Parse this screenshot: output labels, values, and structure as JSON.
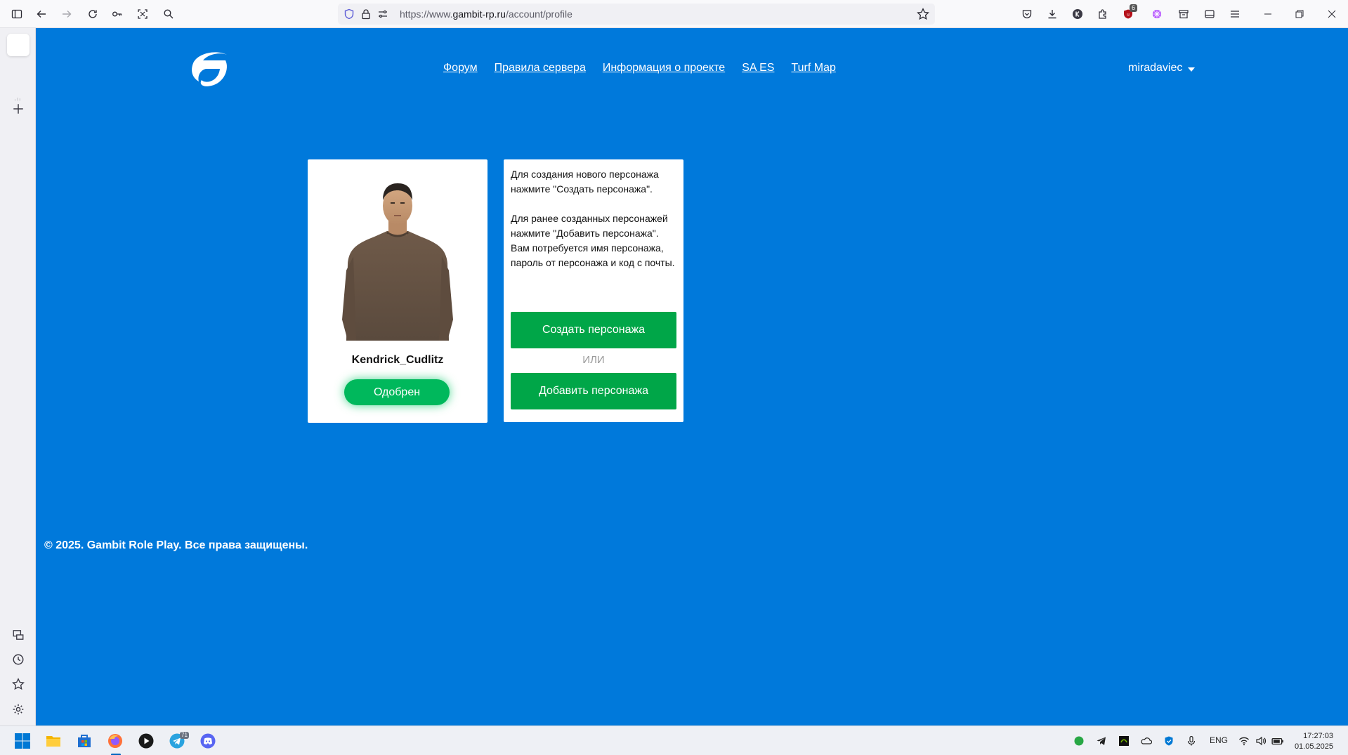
{
  "browser": {
    "url_prefix": "https://www.",
    "url_domain": "gambit-rp.ru",
    "url_path": "/account/profile",
    "extension_badge": "6"
  },
  "site": {
    "nav": [
      {
        "label": "Форум"
      },
      {
        "label": "Правила сервера"
      },
      {
        "label": "Информация о проекте"
      },
      {
        "label": "SA ES"
      },
      {
        "label": "Turf Map"
      }
    ],
    "username": "miradaviec",
    "character": {
      "name": "Kendrick_Cudlitz",
      "status": "Одобрен"
    },
    "info": {
      "paragraph1": "Для создания нового персонажа нажмите \"Создать персонажа\".",
      "paragraph2": "Для ранее созданных персонажей нажмите \"Добавить персонажа\". Вам потребуется имя персонажа, пароль от персонажа и код с почты.",
      "create_button": "Создать персонажа",
      "or_text": "ИЛИ",
      "add_button": "Добавить персонажа"
    },
    "footer": "© 2025. Gambit Role Play. Все права защищены."
  },
  "taskbar": {
    "language": "ENG",
    "time": "17:27:03",
    "date": "01.05.2025",
    "telegram_badge": "71"
  },
  "colors": {
    "page_bg": "#0079db",
    "button_green": "#00a648",
    "status_green": "#00b85c"
  }
}
